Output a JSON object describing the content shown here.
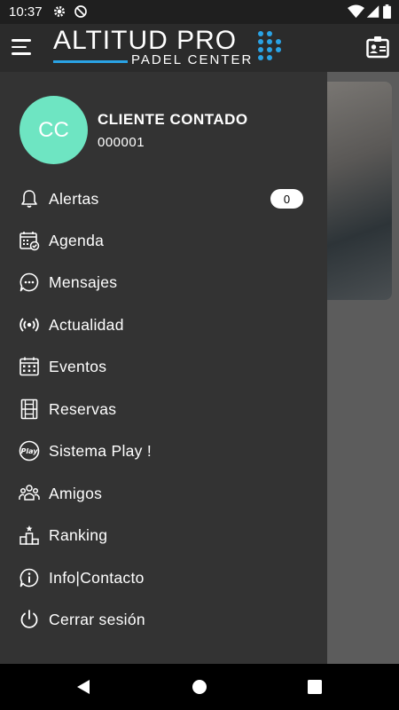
{
  "status_bar": {
    "time": "10:37"
  },
  "app_bar": {
    "logo_main": "ALTITUD PRO",
    "logo_sub": "PADEL CENTER",
    "accent_color": "#2aa3e5"
  },
  "drawer": {
    "avatar_initials": "CC",
    "avatar_color": "#6ee5c2",
    "user_name": "CLIENTE CONTADO",
    "user_id": "000001",
    "items": [
      {
        "label": "Alertas",
        "icon": "bell-icon",
        "badge": "0"
      },
      {
        "label": "Agenda",
        "icon": "calendar-check-icon"
      },
      {
        "label": "Mensajes",
        "icon": "chat-icon"
      },
      {
        "label": "Actualidad",
        "icon": "broadcast-icon"
      },
      {
        "label": "Eventos",
        "icon": "calendar-grid-icon"
      },
      {
        "label": "Reservas",
        "icon": "court-icon"
      },
      {
        "label": "Sistema Play !",
        "icon": "play-logo-icon"
      },
      {
        "label": "Amigos",
        "icon": "people-icon"
      },
      {
        "label": "Ranking",
        "icon": "podium-icon"
      },
      {
        "label": "Info|Contacto",
        "icon": "info-icon"
      },
      {
        "label": "Cerrar sesión",
        "icon": "power-icon"
      }
    ]
  }
}
